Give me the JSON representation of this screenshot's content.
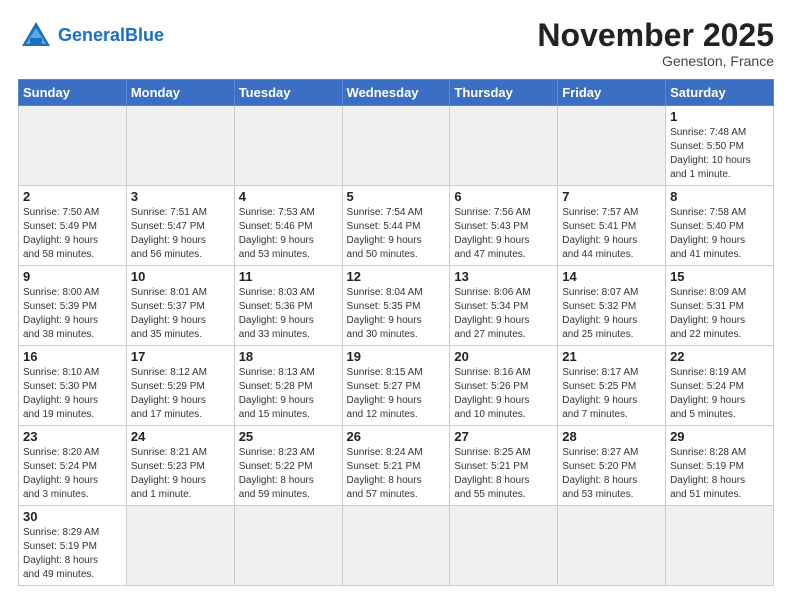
{
  "header": {
    "logo_general": "General",
    "logo_blue": "Blue",
    "month_title": "November 2025",
    "location": "Geneston, France"
  },
  "weekdays": [
    "Sunday",
    "Monday",
    "Tuesday",
    "Wednesday",
    "Thursday",
    "Friday",
    "Saturday"
  ],
  "days": [
    {
      "num": "",
      "info": "",
      "empty": true
    },
    {
      "num": "",
      "info": "",
      "empty": true
    },
    {
      "num": "",
      "info": "",
      "empty": true
    },
    {
      "num": "",
      "info": "",
      "empty": true
    },
    {
      "num": "",
      "info": "",
      "empty": true
    },
    {
      "num": "",
      "info": "",
      "empty": true
    },
    {
      "num": "1",
      "info": "Sunrise: 7:48 AM\nSunset: 5:50 PM\nDaylight: 10 hours\nand 1 minute."
    },
    {
      "num": "2",
      "info": "Sunrise: 7:50 AM\nSunset: 5:49 PM\nDaylight: 9 hours\nand 58 minutes."
    },
    {
      "num": "3",
      "info": "Sunrise: 7:51 AM\nSunset: 5:47 PM\nDaylight: 9 hours\nand 56 minutes."
    },
    {
      "num": "4",
      "info": "Sunrise: 7:53 AM\nSunset: 5:46 PM\nDaylight: 9 hours\nand 53 minutes."
    },
    {
      "num": "5",
      "info": "Sunrise: 7:54 AM\nSunset: 5:44 PM\nDaylight: 9 hours\nand 50 minutes."
    },
    {
      "num": "6",
      "info": "Sunrise: 7:56 AM\nSunset: 5:43 PM\nDaylight: 9 hours\nand 47 minutes."
    },
    {
      "num": "7",
      "info": "Sunrise: 7:57 AM\nSunset: 5:41 PM\nDaylight: 9 hours\nand 44 minutes."
    },
    {
      "num": "8",
      "info": "Sunrise: 7:58 AM\nSunset: 5:40 PM\nDaylight: 9 hours\nand 41 minutes."
    },
    {
      "num": "9",
      "info": "Sunrise: 8:00 AM\nSunset: 5:39 PM\nDaylight: 9 hours\nand 38 minutes."
    },
    {
      "num": "10",
      "info": "Sunrise: 8:01 AM\nSunset: 5:37 PM\nDaylight: 9 hours\nand 35 minutes."
    },
    {
      "num": "11",
      "info": "Sunrise: 8:03 AM\nSunset: 5:36 PM\nDaylight: 9 hours\nand 33 minutes."
    },
    {
      "num": "12",
      "info": "Sunrise: 8:04 AM\nSunset: 5:35 PM\nDaylight: 9 hours\nand 30 minutes."
    },
    {
      "num": "13",
      "info": "Sunrise: 8:06 AM\nSunset: 5:34 PM\nDaylight: 9 hours\nand 27 minutes."
    },
    {
      "num": "14",
      "info": "Sunrise: 8:07 AM\nSunset: 5:32 PM\nDaylight: 9 hours\nand 25 minutes."
    },
    {
      "num": "15",
      "info": "Sunrise: 8:09 AM\nSunset: 5:31 PM\nDaylight: 9 hours\nand 22 minutes."
    },
    {
      "num": "16",
      "info": "Sunrise: 8:10 AM\nSunset: 5:30 PM\nDaylight: 9 hours\nand 19 minutes."
    },
    {
      "num": "17",
      "info": "Sunrise: 8:12 AM\nSunset: 5:29 PM\nDaylight: 9 hours\nand 17 minutes."
    },
    {
      "num": "18",
      "info": "Sunrise: 8:13 AM\nSunset: 5:28 PM\nDaylight: 9 hours\nand 15 minutes."
    },
    {
      "num": "19",
      "info": "Sunrise: 8:15 AM\nSunset: 5:27 PM\nDaylight: 9 hours\nand 12 minutes."
    },
    {
      "num": "20",
      "info": "Sunrise: 8:16 AM\nSunset: 5:26 PM\nDaylight: 9 hours\nand 10 minutes."
    },
    {
      "num": "21",
      "info": "Sunrise: 8:17 AM\nSunset: 5:25 PM\nDaylight: 9 hours\nand 7 minutes."
    },
    {
      "num": "22",
      "info": "Sunrise: 8:19 AM\nSunset: 5:24 PM\nDaylight: 9 hours\nand 5 minutes."
    },
    {
      "num": "23",
      "info": "Sunrise: 8:20 AM\nSunset: 5:24 PM\nDaylight: 9 hours\nand 3 minutes."
    },
    {
      "num": "24",
      "info": "Sunrise: 8:21 AM\nSunset: 5:23 PM\nDaylight: 9 hours\nand 1 minute."
    },
    {
      "num": "25",
      "info": "Sunrise: 8:23 AM\nSunset: 5:22 PM\nDaylight: 8 hours\nand 59 minutes."
    },
    {
      "num": "26",
      "info": "Sunrise: 8:24 AM\nSunset: 5:21 PM\nDaylight: 8 hours\nand 57 minutes."
    },
    {
      "num": "27",
      "info": "Sunrise: 8:25 AM\nSunset: 5:21 PM\nDaylight: 8 hours\nand 55 minutes."
    },
    {
      "num": "28",
      "info": "Sunrise: 8:27 AM\nSunset: 5:20 PM\nDaylight: 8 hours\nand 53 minutes."
    },
    {
      "num": "29",
      "info": "Sunrise: 8:28 AM\nSunset: 5:19 PM\nDaylight: 8 hours\nand 51 minutes."
    },
    {
      "num": "30",
      "info": "Sunrise: 8:29 AM\nSunset: 5:19 PM\nDaylight: 8 hours\nand 49 minutes."
    },
    {
      "num": "",
      "info": "",
      "empty": true
    },
    {
      "num": "",
      "info": "",
      "empty": true
    },
    {
      "num": "",
      "info": "",
      "empty": true
    },
    {
      "num": "",
      "info": "",
      "empty": true
    },
    {
      "num": "",
      "info": "",
      "empty": true
    },
    {
      "num": "",
      "info": "",
      "empty": true
    }
  ]
}
